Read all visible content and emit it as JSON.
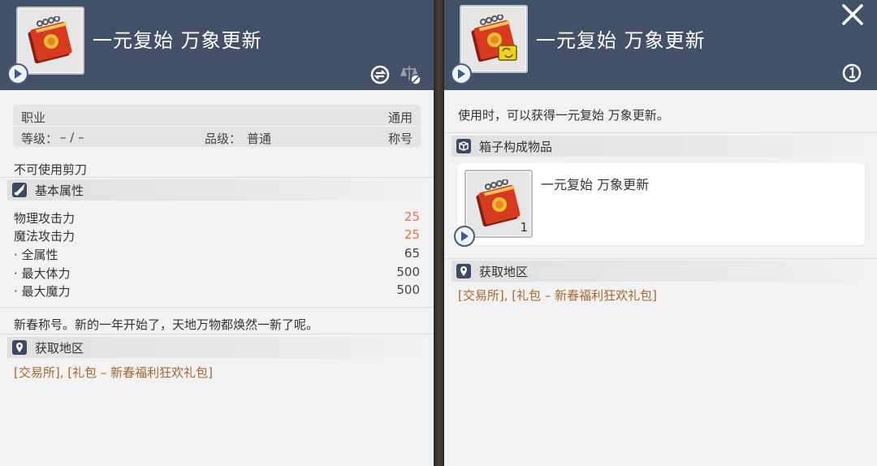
{
  "left": {
    "title": "一元复始 万象更新",
    "job_label": "职业",
    "job_value": "通用",
    "level_label": "等级：",
    "level_value": "– / –",
    "grade_label": "品级：",
    "grade_value": "普通",
    "type_value": "称号",
    "scissors_note": "不可使用剪刀",
    "basic_section": "基本属性",
    "stats": [
      {
        "label": "物理攻击力",
        "value": "25",
        "accent": true
      },
      {
        "label": "魔法攻击力",
        "value": "25",
        "accent": true
      },
      {
        "label": "·  全属性",
        "value": "65",
        "accent": false
      },
      {
        "label": "·  最大体力",
        "value": "500",
        "accent": false
      },
      {
        "label": "·  最大魔力",
        "value": "500",
        "accent": false
      }
    ],
    "description": "新春称号。新的一年开始了，天地万物都焕然一新了呢。",
    "source_section": "获取地区",
    "source_text": "[交易所], [礼包 – 新春福利狂欢礼包]"
  },
  "right": {
    "title": "一元复始 万象更新",
    "use_text": "使用时，可以获得一元复始 万象更新。",
    "contents_section": "箱子构成物品",
    "content_item_name": "一元复始 万象更新",
    "content_item_qty": "1",
    "source_section": "获取地区",
    "source_text": "[交易所], [礼包 – 新春福利狂欢礼包]"
  },
  "colors": {
    "header": "#435168",
    "accent_value": "#e8734a",
    "source_link": "#a8652c"
  },
  "icons": [
    "play-icon",
    "exchange-icon",
    "scale-icon",
    "close-icon",
    "info-icon",
    "sword-icon",
    "box-icon",
    "location-icon",
    "red-book-icon"
  ]
}
